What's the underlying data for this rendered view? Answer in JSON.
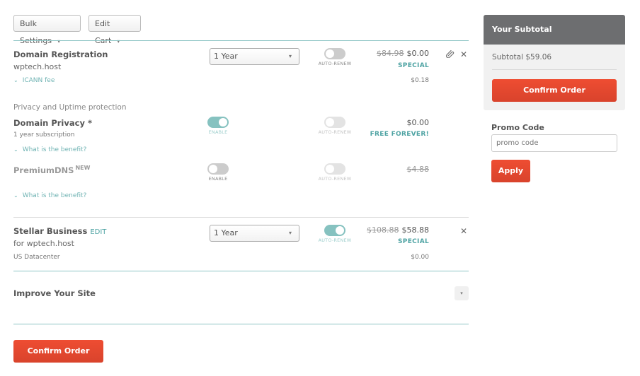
{
  "toolbar": {
    "bulk_settings": "Bulk Settings",
    "edit_cart": "Edit Cart"
  },
  "domain_registration": {
    "title": "Domain Registration",
    "domain": "wptech.host",
    "icann_link": "ICANN fee",
    "term": "1 Year",
    "auto_renew_label": "AUTO-RENEW",
    "auto_renew": false,
    "old_price": "$84.98",
    "price": "$0.00",
    "badge": "SPECIAL",
    "icann_fee": "$0.18"
  },
  "privacy_section": {
    "heading": "Privacy and Uptime protection",
    "domain_privacy": {
      "title": "Domain Privacy *",
      "subtitle": "1 year subscription",
      "link": "What is the benefit?",
      "enable_label": "ENABLE",
      "enabled": true,
      "auto_renew_label": "AUTO-RENEW",
      "price": "$0.00",
      "badge": "FREE FOREVER!"
    },
    "premium_dns": {
      "title": "PremiumDNS",
      "new_badge": "NEW",
      "link": "What is the benefit?",
      "enable_label": "ENABLE",
      "enabled": false,
      "auto_renew_label": "AUTO-RENEW",
      "price": "$4.88"
    }
  },
  "hosting": {
    "title": "Stellar Business",
    "edit_label": "EDIT",
    "domain": "for wptech.host",
    "datacenter": "US Datacenter",
    "term": "1 Year",
    "auto_renew_label": "AUTO-RENEW",
    "auto_renew": true,
    "old_price": "$108.88",
    "price": "$58.88",
    "badge": "SPECIAL",
    "datacenter_price": "$0.00"
  },
  "improve": {
    "title": "Improve Your Site"
  },
  "confirm_bottom": "Confirm Order",
  "sidebar": {
    "header": "Your Subtotal",
    "subtotal": "Subtotal $59.06",
    "confirm": "Confirm Order",
    "promo_label": "Promo Code",
    "promo_placeholder": "promo code",
    "apply": "Apply"
  },
  "colors": {
    "accent_teal": "#86c2c0",
    "cta_red": "#e6482f",
    "sidebar_header": "#6d6e70"
  }
}
